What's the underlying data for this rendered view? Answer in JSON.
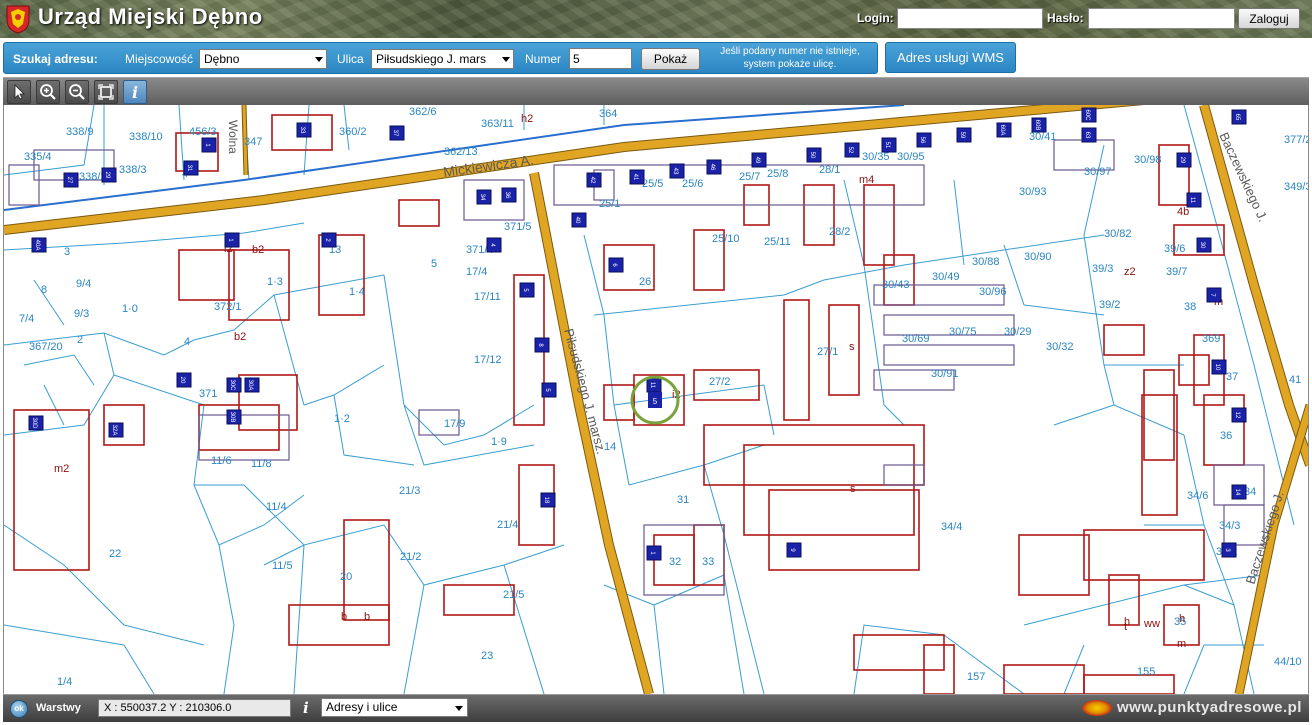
{
  "header": {
    "title": "Urząd Miejski Dębno",
    "login_label": "Login:",
    "password_label": "Hasło:",
    "login_value": "",
    "password_value": "",
    "login_button": "Zaloguj"
  },
  "search": {
    "label": "Szukaj adresu:",
    "town_label": "Miejscowość",
    "town_value": "Dębno",
    "street_label": "Ulica",
    "street_value": "Piłsudskiego J. mars",
    "number_label": "Numer",
    "number_value": "5",
    "show_button": "Pokaż",
    "hint_line1": "Jeśli podany numer nie istnieje,",
    "hint_line2": "system pokaże ulicę.",
    "wms_button": "Adres usługi WMS"
  },
  "toolbar": {
    "tools": [
      "pointer-icon",
      "zoom-in-icon",
      "zoom-out-icon",
      "full-extent-icon",
      "info-icon"
    ],
    "active_tool": "info-icon"
  },
  "map": {
    "streets": [
      "Mickiewicza A.",
      "Piłsudskiego J. marsz.",
      "Baczewskiego J.",
      "Baczewskiego J.",
      "Wolna"
    ],
    "parcels": [
      {
        "t": "335/4"
      },
      {
        "t": "338/9"
      },
      {
        "t": "338/10"
      },
      {
        "t": "456/3"
      },
      {
        "t": "347"
      },
      {
        "t": "360/2"
      },
      {
        "t": "362/6"
      },
      {
        "t": "363/11"
      },
      {
        "t": "364"
      },
      {
        "t": "362/13"
      },
      {
        "t": "338/2"
      },
      {
        "t": "338/3"
      },
      {
        "t": "4"
      },
      {
        "t": "h2"
      },
      {
        "t": "30/41"
      },
      {
        "t": "30/95"
      },
      {
        "t": "30/35"
      },
      {
        "t": "377/2"
      },
      {
        "t": "30/98"
      },
      {
        "t": "349/3"
      },
      {
        "t": "25/1"
      },
      {
        "t": "25/5"
      },
      {
        "t": "25/6"
      },
      {
        "t": "25/7"
      },
      {
        "t": "25/8"
      },
      {
        "t": "28/1"
      },
      {
        "t": "30/93"
      },
      {
        "t": "30/97"
      },
      {
        "t": "4b"
      },
      {
        "t": "371/5"
      },
      {
        "t": "i2"
      },
      {
        "t": "b2"
      },
      {
        "t": "13"
      },
      {
        "t": "3"
      },
      {
        "t": "5"
      },
      {
        "t": "371/4"
      },
      {
        "t": "17/4"
      },
      {
        "t": "17/11"
      },
      {
        "t": "25/10"
      },
      {
        "t": "25/11"
      },
      {
        "t": "28/2"
      },
      {
        "t": "30/88"
      },
      {
        "t": "30/90"
      },
      {
        "t": "30/82"
      },
      {
        "t": "39/6"
      },
      {
        "t": "39/3"
      },
      {
        "t": "z2"
      },
      {
        "t": "39/7"
      },
      {
        "t": "9/4"
      },
      {
        "t": "8"
      },
      {
        "t": "9/3"
      },
      {
        "t": "7/4"
      },
      {
        "t": "1·0"
      },
      {
        "t": "372/1"
      },
      {
        "t": "1·3"
      },
      {
        "t": "1·4"
      },
      {
        "t": "26"
      },
      {
        "t": "30/43"
      },
      {
        "t": "30/49"
      },
      {
        "t": "30/96"
      },
      {
        "t": "39/2"
      },
      {
        "t": "38"
      },
      {
        "t": "m"
      },
      {
        "t": "367/20"
      },
      {
        "t": "2"
      },
      {
        "t": "4"
      },
      {
        "t": "b2"
      },
      {
        "t": "17/12"
      },
      {
        "t": "27/1"
      },
      {
        "t": "s"
      },
      {
        "t": "30/69"
      },
      {
        "t": "30/75"
      },
      {
        "t": "30/29"
      },
      {
        "t": "30/32"
      },
      {
        "t": "369"
      },
      {
        "t": "27/2"
      },
      {
        "t": "i2"
      },
      {
        "t": "30/91"
      },
      {
        "t": "371"
      },
      {
        "t": "1·2"
      },
      {
        "t": "17/9"
      },
      {
        "t": "1·9"
      },
      {
        "t": "14"
      },
      {
        "t": "37"
      },
      {
        "t": "41"
      },
      {
        "t": "m2"
      },
      {
        "t": "11/6"
      },
      {
        "t": "11/8"
      },
      {
        "t": "36"
      },
      {
        "t": "11/4"
      },
      {
        "t": "21/3"
      },
      {
        "t": "21/4"
      },
      {
        "t": "31"
      },
      {
        "t": "s"
      },
      {
        "t": "34/6"
      },
      {
        "t": "34"
      },
      {
        "t": "34/4"
      },
      {
        "t": "34/3"
      },
      {
        "t": "22"
      },
      {
        "t": "11/5"
      },
      {
        "t": "21/2"
      },
      {
        "t": "20"
      },
      {
        "t": "b"
      },
      {
        "t": "33"
      },
      {
        "t": "32"
      },
      {
        "t": "34/2"
      },
      {
        "t": "21/5"
      },
      {
        "t": "b"
      },
      {
        "t": "35"
      },
      {
        "t": "m"
      },
      {
        "t": "h"
      },
      {
        "t": "ww"
      },
      {
        "t": "23"
      },
      {
        "t": "1/4"
      },
      {
        "t": "155"
      },
      {
        "t": "157"
      },
      {
        "t": "44/10"
      },
      {
        "t": "m4"
      },
      {
        "t": "h"
      },
      {
        "t": "t"
      }
    ],
    "address_points": [
      "33",
      "37",
      "1",
      "31",
      "27",
      "29",
      "42",
      "41",
      "43",
      "46",
      "49",
      "50",
      "52",
      "51",
      "56",
      "59",
      "60A",
      "60B",
      "60C",
      "63",
      "65",
      "29",
      "11",
      "30",
      "34",
      "36",
      "40",
      "40A",
      "1",
      "2",
      "4",
      "5",
      "8",
      "5",
      "6",
      "7",
      "10",
      "12",
      "14",
      "18",
      "20",
      "30C",
      "30A",
      "30B",
      "32A",
      "30D",
      "11",
      "9",
      "3",
      "1"
    ],
    "selected_address": "5"
  },
  "statusbar": {
    "ok_label": "ok",
    "layers_label": "Warstwy",
    "coords": "X : 550037.2  Y : 210306.0",
    "layer_value": "Adresy i ulice",
    "brand": "www.punktyadresowe.pl"
  }
}
